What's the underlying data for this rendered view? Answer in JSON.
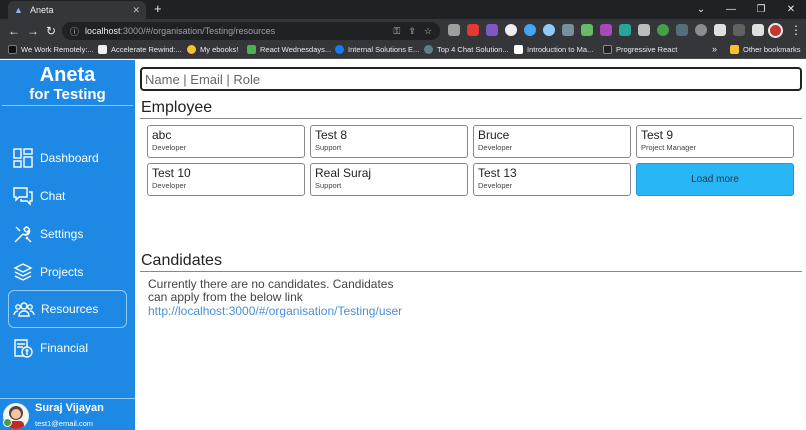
{
  "browser": {
    "tab_title": "Aneta",
    "url_host": "localhost",
    "url_path": ":3000/#/organisation/Testing/resources",
    "bookmarks": [
      {
        "label": "We Work Remotely:..."
      },
      {
        "label": "Accelerate Rewind:..."
      },
      {
        "label": "My ebooks!"
      },
      {
        "label": "React Wednesdays..."
      },
      {
        "label": "Internal Solutions E..."
      },
      {
        "label": "Top 4 Chat Solution..."
      },
      {
        "label": "Introduction to Ma..."
      },
      {
        "label": "Progressive React"
      },
      {
        "label": "Other bookmarks"
      }
    ]
  },
  "sidebar": {
    "brand_name": "Aneta",
    "brand_sub": "for Testing",
    "items": [
      {
        "label": "Dashboard",
        "icon": "dashboard-icon"
      },
      {
        "label": "Chat",
        "icon": "chat-icon"
      },
      {
        "label": "Settings",
        "icon": "settings-icon"
      },
      {
        "label": "Projects",
        "icon": "projects-icon"
      },
      {
        "label": "Resources",
        "icon": "resources-icon",
        "active": true
      },
      {
        "label": "Financial",
        "icon": "financial-icon"
      }
    ],
    "user": {
      "name": "Suraj Vijayan",
      "email": "test1@email.com"
    }
  },
  "main": {
    "search_placeholder": "Name | Email | Role",
    "employee_title": "Employee",
    "employees": [
      {
        "name": "abc",
        "role": "Developer"
      },
      {
        "name": "Test 8",
        "role": "Support"
      },
      {
        "name": "Bruce",
        "role": "Developer"
      },
      {
        "name": "Test 9",
        "role": "Project Manager"
      },
      {
        "name": "Test 10",
        "role": "Developer"
      },
      {
        "name": "Real Suraj",
        "role": "Support"
      },
      {
        "name": "Test 13",
        "role": "Developer"
      }
    ],
    "load_more_label": "Load more",
    "candidates_title": "Candidates",
    "candidates_text": "Currently there are no candidates. Candidates can apply from the below link",
    "candidates_link": "http://localhost:3000/#/organisation/Testing/user"
  },
  "colors": {
    "sidebar": "#1e88e5",
    "load_more": "#29b6f6",
    "link": "#4a90d9"
  }
}
